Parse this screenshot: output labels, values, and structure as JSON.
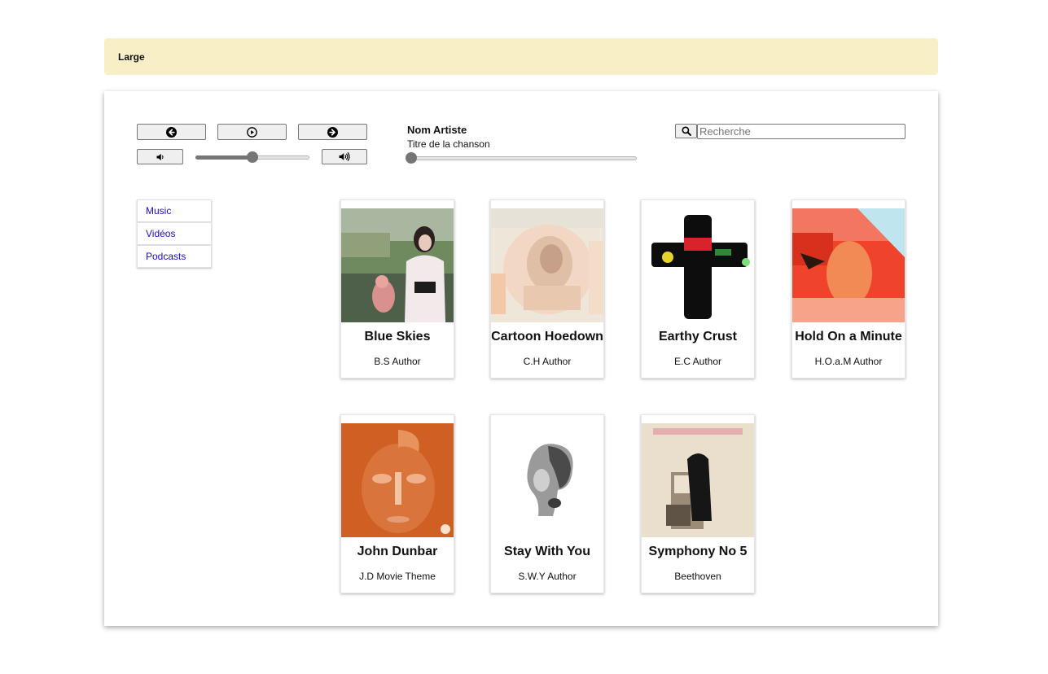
{
  "banner": {
    "label": "Large"
  },
  "player": {
    "prev_icon": "arrow-left-circle-icon",
    "play_icon": "play-circle-icon",
    "next_icon": "arrow-right-circle-icon",
    "volume_down_icon": "volume-down-icon",
    "volume_up_icon": "volume-up-icon",
    "volume_level": 0.5,
    "seek_position": 0.0,
    "artist": "Nom Artiste",
    "song_title": "Titre de la chanson"
  },
  "search": {
    "icon": "search-icon",
    "placeholder": "Recherche",
    "value": ""
  },
  "nav": {
    "items": [
      {
        "label": "Music"
      },
      {
        "label": "Vidéos"
      },
      {
        "label": "Podcasts"
      }
    ]
  },
  "albums": [
    {
      "title": "Blue Skies",
      "author": "B.S Author"
    },
    {
      "title": "Cartoon Hoedown",
      "author": "C.H Author"
    },
    {
      "title": "Earthy Crust",
      "author": "E.C Author"
    },
    {
      "title": "Hold On a Minute",
      "author": "H.O.a.M Author"
    },
    {
      "title": "John Dunbar",
      "author": "J.D Movie Theme"
    },
    {
      "title": "Stay With You",
      "author": "S.W.Y Author"
    },
    {
      "title": "Symphony No 5",
      "author": "Beethoven"
    }
  ]
}
